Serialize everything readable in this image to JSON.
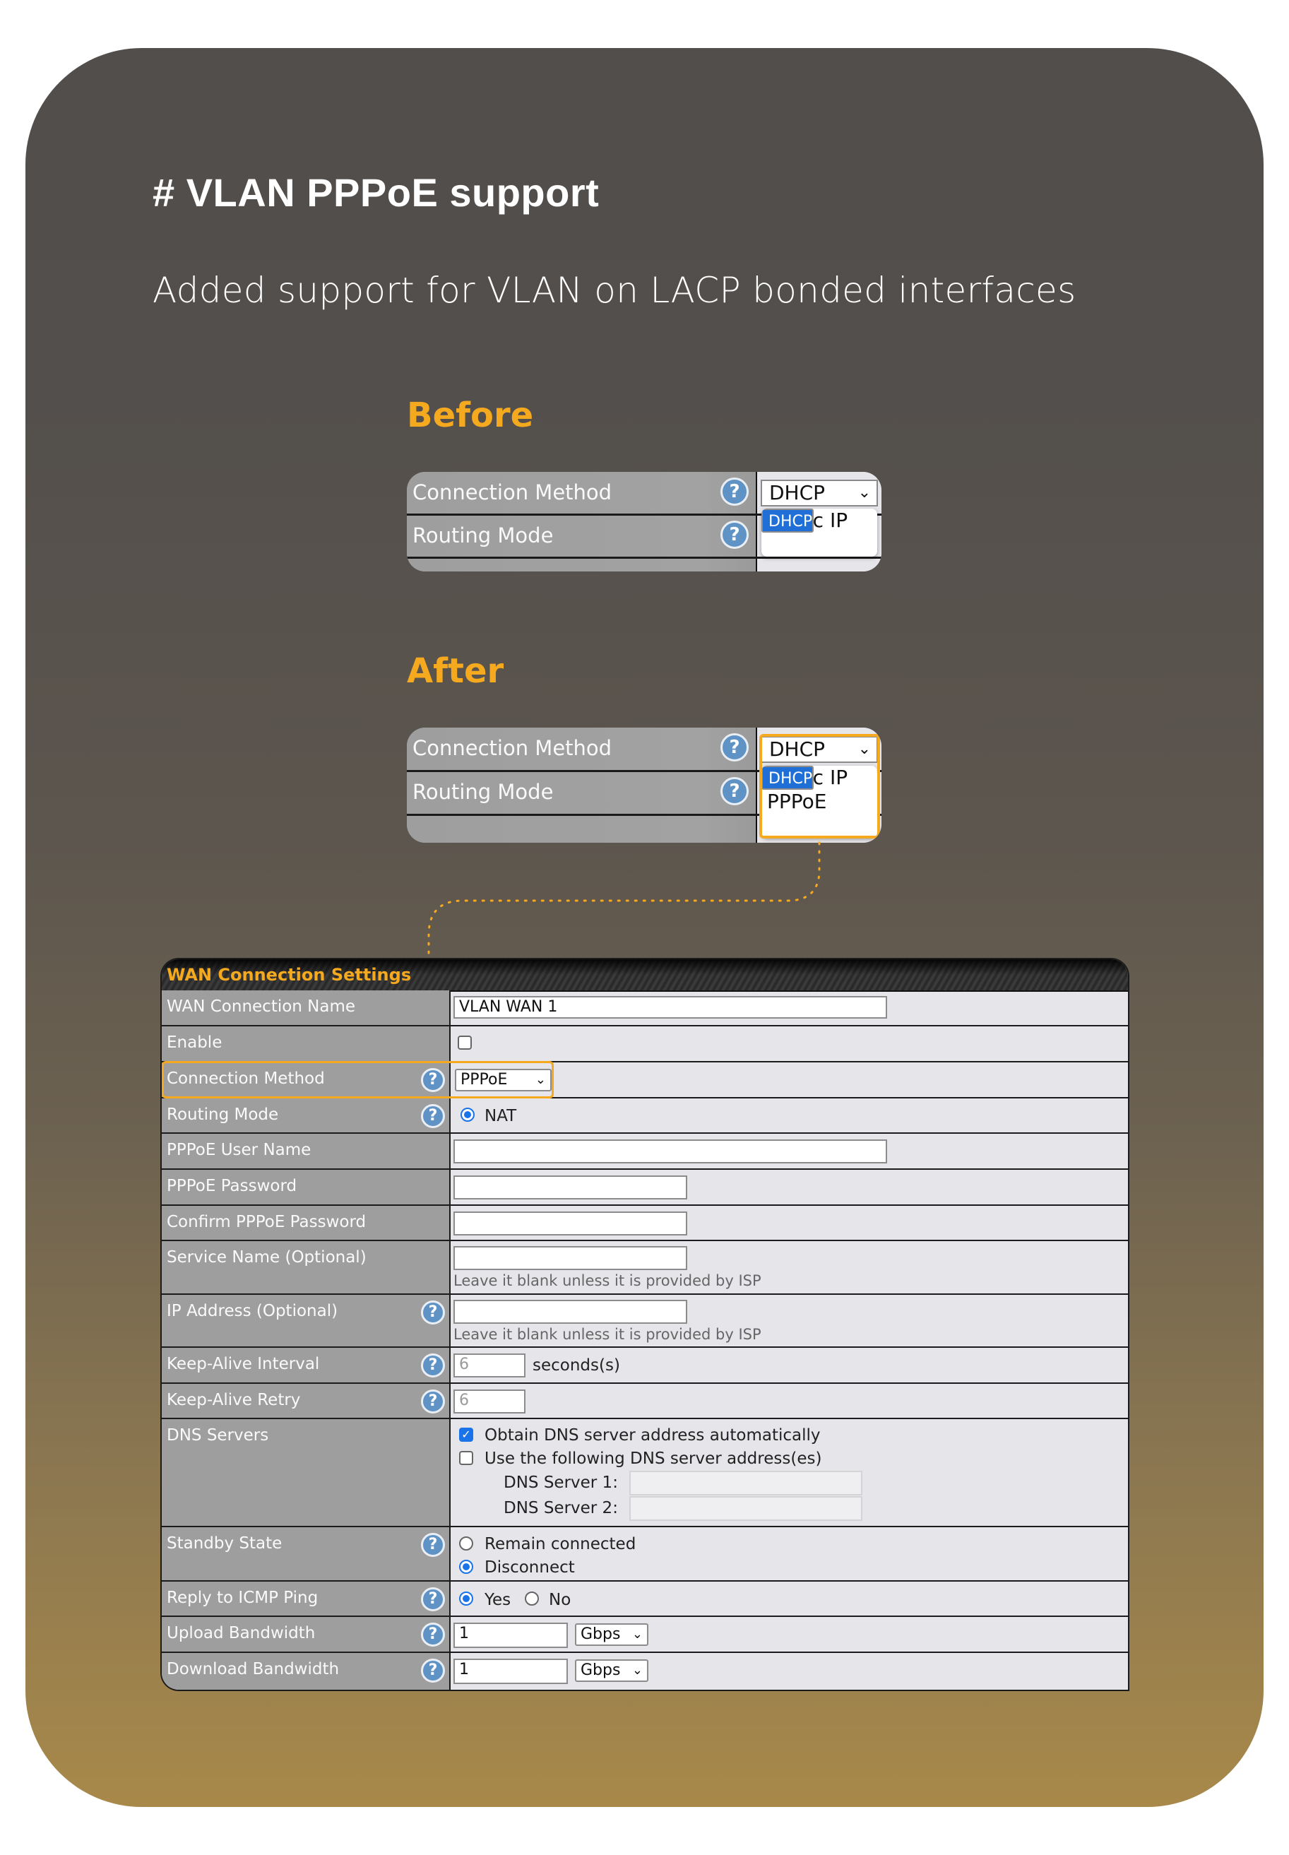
{
  "title": "# VLAN PPPoE support",
  "subtitle": "Added support for VLAN on LACP bonded interfaces",
  "colors": {
    "accent": "#f5a91e",
    "select_highlight": "#1f6fd6",
    "help_icon": "#5f93c6"
  },
  "before": {
    "heading": "Before",
    "rows": [
      {
        "label": "Connection Method",
        "icon": "help-icon"
      },
      {
        "label": "Routing Mode",
        "icon": "help-icon"
      }
    ],
    "select_value": "DHCP",
    "options": [
      "DHCP",
      "Static IP"
    ],
    "highlighted_option": "DHCP"
  },
  "after": {
    "heading": "After",
    "rows": [
      {
        "label": "Connection Method",
        "icon": "help-icon"
      },
      {
        "label": "Routing Mode",
        "icon": "help-icon"
      }
    ],
    "select_value": "DHCP",
    "options": [
      "DHCP",
      "Static IP",
      "PPPoE"
    ],
    "highlighted_option": "DHCP"
  },
  "wan": {
    "header": "WAN Connection Settings",
    "rows": {
      "name": {
        "label": "WAN Connection Name",
        "value": "VLAN WAN 1"
      },
      "enable": {
        "label": "Enable",
        "checked": false
      },
      "method": {
        "label": "Connection Method",
        "value": "PPPoE"
      },
      "routing": {
        "label": "Routing Mode",
        "option": "NAT",
        "selected": true
      },
      "user": {
        "label": "PPPoE User Name",
        "value": ""
      },
      "password": {
        "label": "PPPoE Password",
        "value": ""
      },
      "confirm": {
        "label": "Confirm PPPoE Password",
        "value": ""
      },
      "service": {
        "label": "Service Name (Optional)",
        "value": "",
        "hint": "Leave it blank unless it is provided by ISP"
      },
      "ip": {
        "label": "IP Address (Optional)",
        "value": "",
        "hint": "Leave it blank unless it is provided by ISP"
      },
      "ka_interval": {
        "label": "Keep-Alive Interval",
        "value": "6",
        "unit": "seconds(s)"
      },
      "ka_retry": {
        "label": "Keep-Alive Retry",
        "value": "6"
      },
      "dns": {
        "label": "DNS Servers",
        "auto_label": "Obtain DNS server address automatically",
        "auto_checked": true,
        "manual_label": "Use the following DNS server address(es)",
        "manual_checked": false,
        "server1_label": "DNS Server 1:",
        "server2_label": "DNS Server 2:",
        "server1_value": "",
        "server2_value": ""
      },
      "standby": {
        "label": "Standby State",
        "opt1": "Remain connected",
        "opt2": "Disconnect",
        "selected": "Disconnect"
      },
      "icmp": {
        "label": "Reply to ICMP Ping",
        "opt1": "Yes",
        "opt2": "No",
        "selected": "Yes"
      },
      "upload": {
        "label": "Upload Bandwidth",
        "value": "1",
        "unit": "Gbps"
      },
      "download": {
        "label": "Download Bandwidth",
        "value": "1",
        "unit": "Gbps"
      }
    }
  }
}
